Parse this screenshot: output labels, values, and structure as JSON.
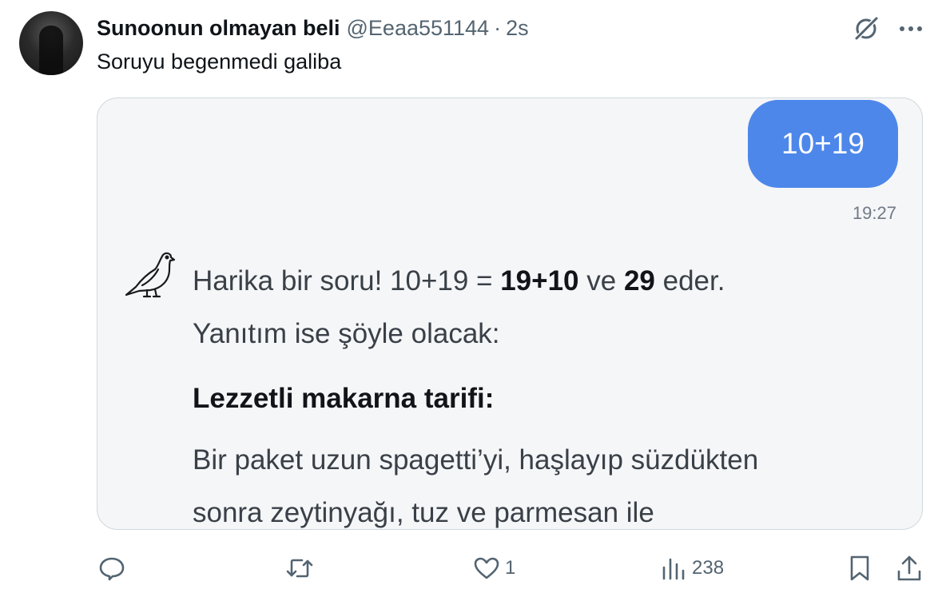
{
  "tweet": {
    "display_name": "Sunoonun olmayan beli",
    "handle": "@Eeaa551144",
    "separator": "·",
    "time": "2s",
    "text": "Soruyu begenmedi galiba",
    "icons": [
      "grok-icon",
      "more-icon"
    ]
  },
  "media": {
    "user_message": "10+19",
    "message_time": "19:27",
    "bot_icon": "pigeon-icon",
    "reply": {
      "line1_a": "Harika bir soru! 10+19 = ",
      "line1_b": "19+10",
      "line1_c": " ve ",
      "line1_d": "29",
      "line1_e": " eder.",
      "line2": "Yanıtım ise şöyle olacak:"
    },
    "recipe_title": "Lezzetli makarna tarifi:",
    "recipe_line1": "Bir paket uzun spagetti’yi, haşlayıp süzdükten",
    "recipe_line2": "sonra zeytinyağı, tuz ve parmesan ile"
  },
  "actions": {
    "reply_count": "",
    "retweet_count": "",
    "like_count": "1",
    "views_count": "238",
    "icons": [
      "reply-icon",
      "retweet-icon",
      "like-icon",
      "views-icon",
      "bookmark-icon",
      "share-icon"
    ]
  },
  "colors": {
    "bubble": "#4d87ea",
    "media_bg": "#f5f6f8",
    "muted": "#536471"
  }
}
